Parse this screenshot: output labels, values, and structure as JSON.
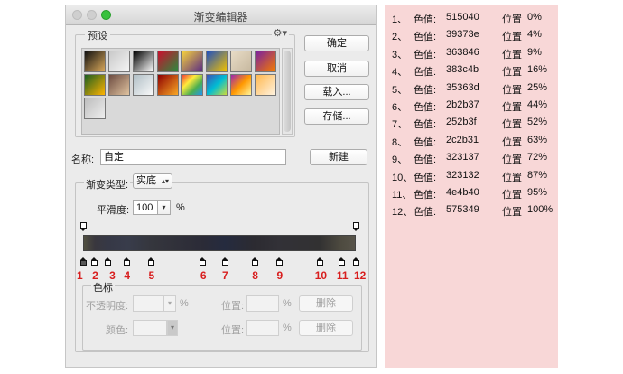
{
  "dialog": {
    "title": "渐变编辑器",
    "presets_label": "预设",
    "gear_icon": "gear-icon",
    "buttons": {
      "ok": "确定",
      "cancel": "取消",
      "load": "载入...",
      "save": "存储...",
      "new": "新建"
    },
    "name_label": "名称:",
    "name_value": "自定",
    "gradient_type_label": "渐变类型:",
    "gradient_type_value": "实底",
    "smoothness_label": "平滑度:",
    "smoothness_value": "100",
    "smoothness_unit": "%",
    "stops_group_label": "色标",
    "opacity_label": "不透明度:",
    "opacity_unit": "%",
    "color_label": "颜色:",
    "location_label": "位置:",
    "location_unit": "%",
    "delete_label": "删除",
    "preset_swatches": [
      "linear-gradient(135deg,#111,#d9a85a)",
      "linear-gradient(135deg,#c9c9c9,#f5f5f5)",
      "linear-gradient(135deg,#000,#fff)",
      "linear-gradient(135deg,#c8102e,#2b8a3e)",
      "linear-gradient(135deg,#f4d03f,#5b2c83)",
      "linear-gradient(135deg,#1f4fbf,#f2c200)",
      "linear-gradient(135deg,#e8dcc6,#c7b89f)",
      "linear-gradient(135deg,#7a1fa0,#f57c00)",
      "linear-gradient(135deg,#1b5e20,#ffb300)",
      "linear-gradient(135deg,#6d4c41,#e0c3a0)",
      "linear-gradient(135deg,#b0bec5,#fafafa)",
      "linear-gradient(135deg,#8e0000,#f9a825)",
      "linear-gradient(135deg,#f44336,#ffeb3b,#4caf50,#2196f3)",
      "linear-gradient(135deg,#3f51b5,#00bcd4,#cddc39)",
      "linear-gradient(135deg,#9c27b0,#ff9800,#fff59d)",
      "linear-gradient(135deg,#ffb74d,#fff3e0)",
      "linear-gradient(135deg,#bdbdbd,#eeeeee)"
    ],
    "stop_numbers": [
      "1",
      "2",
      "3",
      "4",
      "5",
      "6",
      "7",
      "8",
      "9",
      "10",
      "11",
      "12"
    ]
  },
  "panel": {
    "color_prefix": "色值:",
    "position_prefix": "位置",
    "entries": [
      {
        "index": "1、",
        "color": "515040",
        "position": "0%"
      },
      {
        "index": "2、",
        "color": "39373e",
        "position": "4%"
      },
      {
        "index": "3、",
        "color": "363846",
        "position": "9%"
      },
      {
        "index": "4、",
        "color": "383c4b",
        "position": "16%"
      },
      {
        "index": "5、",
        "color": "35363d",
        "position": "25%"
      },
      {
        "index": "6、",
        "color": "2b2b37",
        "position": "44%"
      },
      {
        "index": "7、",
        "color": "252b3f",
        "position": "52%"
      },
      {
        "index": "8、",
        "color": "2c2b31",
        "position": "63%"
      },
      {
        "index": "9、",
        "color": "323137",
        "position": "72%"
      },
      {
        "index": "10、",
        "color": "323132",
        "position": "87%"
      },
      {
        "index": "11、",
        "color": "4e4b40",
        "position": "95%"
      },
      {
        "index": "12、",
        "color": "575349",
        "position": "100%"
      }
    ]
  },
  "colors": {
    "panel_background": "#f8d7d7",
    "stop_number": "#d81e1e",
    "zoom_button": "#39c13e"
  }
}
